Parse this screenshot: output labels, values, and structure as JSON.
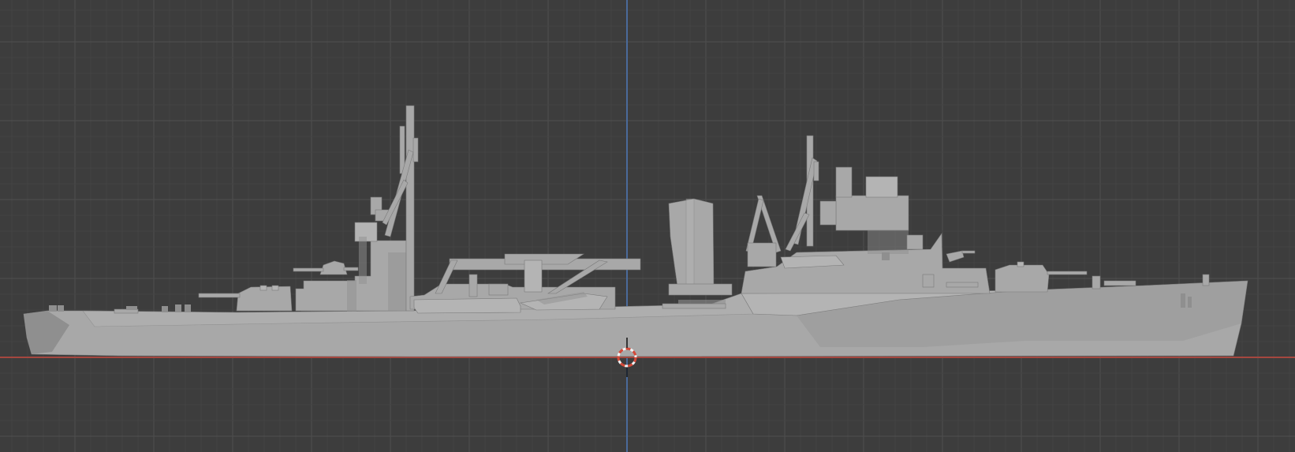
{
  "viewport": {
    "view": "orthographic-side",
    "object": "ship-model",
    "colors": {
      "background": "#3d3d3d",
      "grid_minor": "#444444",
      "grid_major": "#4f4f4f",
      "x_axis": "#a5473f",
      "z_axis": "#4a6a9a",
      "model_base": "#a8a8a8",
      "model_light": "#b4b4b4",
      "model_dark": "#8f8f8f",
      "model_edge": "#7a7a7a",
      "cursor_red": "#d44a3a",
      "cursor_white": "#f2f2f2"
    },
    "icons": [
      "3d-cursor-icon"
    ]
  }
}
